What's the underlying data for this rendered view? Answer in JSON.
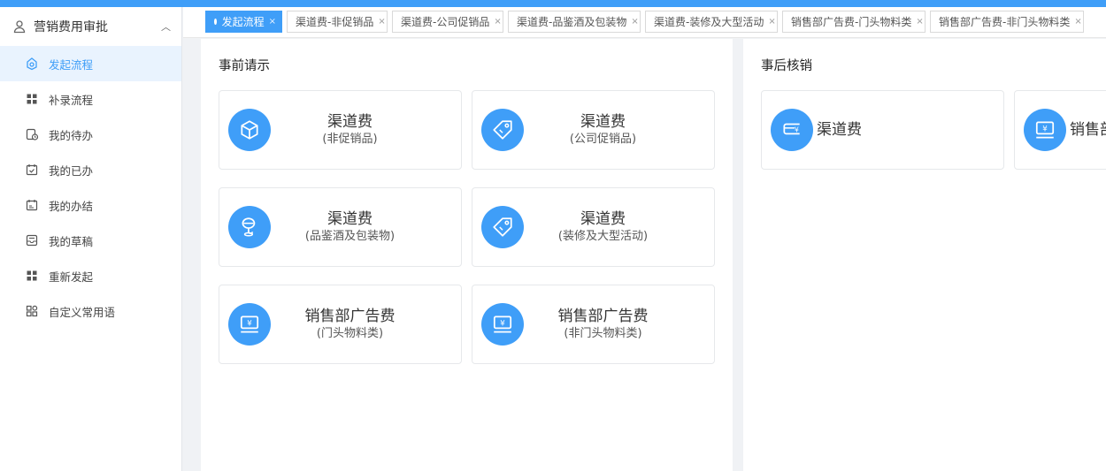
{
  "sidebar": {
    "header": "营销费用审批",
    "items": [
      {
        "label": "发起流程",
        "icon": "flow-icon",
        "active": true
      },
      {
        "label": "补录流程",
        "icon": "grid-icon"
      },
      {
        "label": "我的待办",
        "icon": "todo-icon"
      },
      {
        "label": "我的已办",
        "icon": "calendar-check-icon"
      },
      {
        "label": "我的办结",
        "icon": "calendar-done-icon"
      },
      {
        "label": "我的草稿",
        "icon": "draft-icon"
      },
      {
        "label": "重新发起",
        "icon": "grid-icon"
      },
      {
        "label": "自定义常用语",
        "icon": "apps-icon"
      }
    ]
  },
  "tabs": [
    {
      "label": "发起流程",
      "active": true
    },
    {
      "label": "渠道费-非促销品"
    },
    {
      "label": "渠道费-公司促销品"
    },
    {
      "label": "渠道费-品鉴酒及包装物"
    },
    {
      "label": "渠道费-装修及大型活动"
    },
    {
      "label": "销售部广告费-门头物料类"
    },
    {
      "label": "销售部广告费-非门头物料类"
    }
  ],
  "left_panel": {
    "title": "事前请示",
    "cards": [
      {
        "t1": "渠道费",
        "t2": "(非促销品)",
        "icon": "box-icon"
      },
      {
        "t1": "渠道费",
        "t2": "(公司促销品)",
        "icon": "tag-icon"
      },
      {
        "t1": "渠道费",
        "t2": "(品鉴酒及包装物)",
        "icon": "wine-icon"
      },
      {
        "t1": "渠道费",
        "t2": "(装修及大型活动)",
        "icon": "tag-icon"
      },
      {
        "t1": "销售部广告费",
        "t2": "(门头物料类)",
        "icon": "monitor-yen-icon"
      },
      {
        "t1": "销售部广告费",
        "t2": "(非门头物料类)",
        "icon": "monitor-yen-icon"
      }
    ]
  },
  "right_panel": {
    "title": "事后核销",
    "cards": [
      {
        "t1": "渠道费",
        "icon": "card-yen-icon"
      },
      {
        "t1": "销售部",
        "icon": "monitor-yen-icon"
      }
    ]
  },
  "colors": {
    "accent": "#3f9ef8",
    "active_bg": "#e9f3fe"
  }
}
